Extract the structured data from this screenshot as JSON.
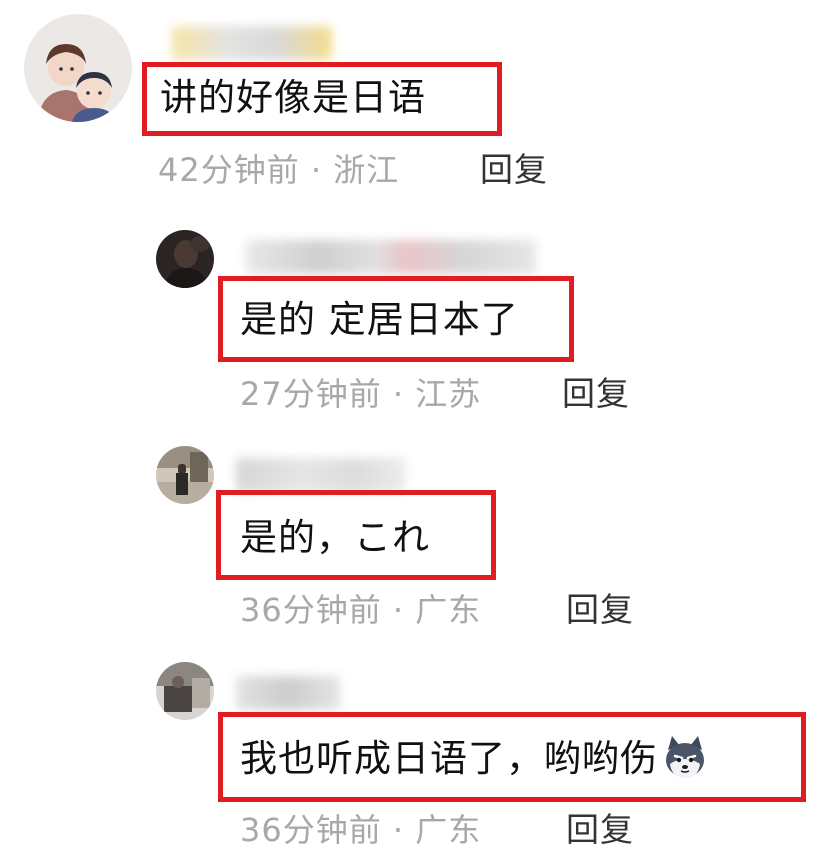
{
  "colors": {
    "highlight": "#e21c23",
    "meta_text": "#a8a8a8",
    "reply_text": "#333333",
    "comment_text": "#111111"
  },
  "comments": [
    {
      "text": "讲的好像是日语",
      "time": "42分钟前",
      "separator": "·",
      "location": "浙江",
      "reply_label": "回复",
      "avatar_icon": "cartoon-couple-avatar"
    },
    {
      "text": "是的 定居日本了",
      "time": "27分钟前",
      "separator": "·",
      "location": "江苏",
      "reply_label": "回复",
      "avatar_icon": "dark-portrait-avatar"
    },
    {
      "text": "是的，これ",
      "time": "36分钟前",
      "separator": "·",
      "location": "广东",
      "reply_label": "回复",
      "avatar_icon": "street-photo-avatar"
    },
    {
      "text": "我也听成日语了，哟哟伤",
      "emoji_icon": "husky-dog-emoji",
      "time": "36分钟前",
      "separator": "·",
      "location": "广东",
      "reply_label": "回复",
      "avatar_icon": "indoor-photo-avatar"
    }
  ]
}
